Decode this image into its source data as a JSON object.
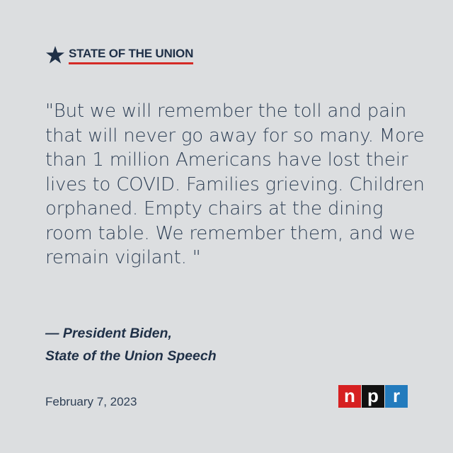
{
  "header": {
    "title": "STATE OF THE UNION",
    "icon": "star-icon",
    "icon_color": "#1f3047",
    "underline_color": "#d52b26"
  },
  "quote": {
    "text": "\"But we will remember the toll and pain that will never go away for so many. More than 1 million Americans have lost their lives to COVID. Families grieving. Children orphaned. Empty chairs at the dining room table. We remember them, and we remain vigilant. \""
  },
  "attribution": {
    "line1": "— President Biden,",
    "line2": "State of the Union Speech"
  },
  "date": "February 7, 2023",
  "logo": {
    "letters": [
      {
        "char": "n",
        "color": "#d62021"
      },
      {
        "char": "p",
        "color": "#111111"
      },
      {
        "char": "r",
        "color": "#237bbd"
      }
    ]
  },
  "colors": {
    "background": "#dcdee0",
    "text": "#2f4056"
  }
}
